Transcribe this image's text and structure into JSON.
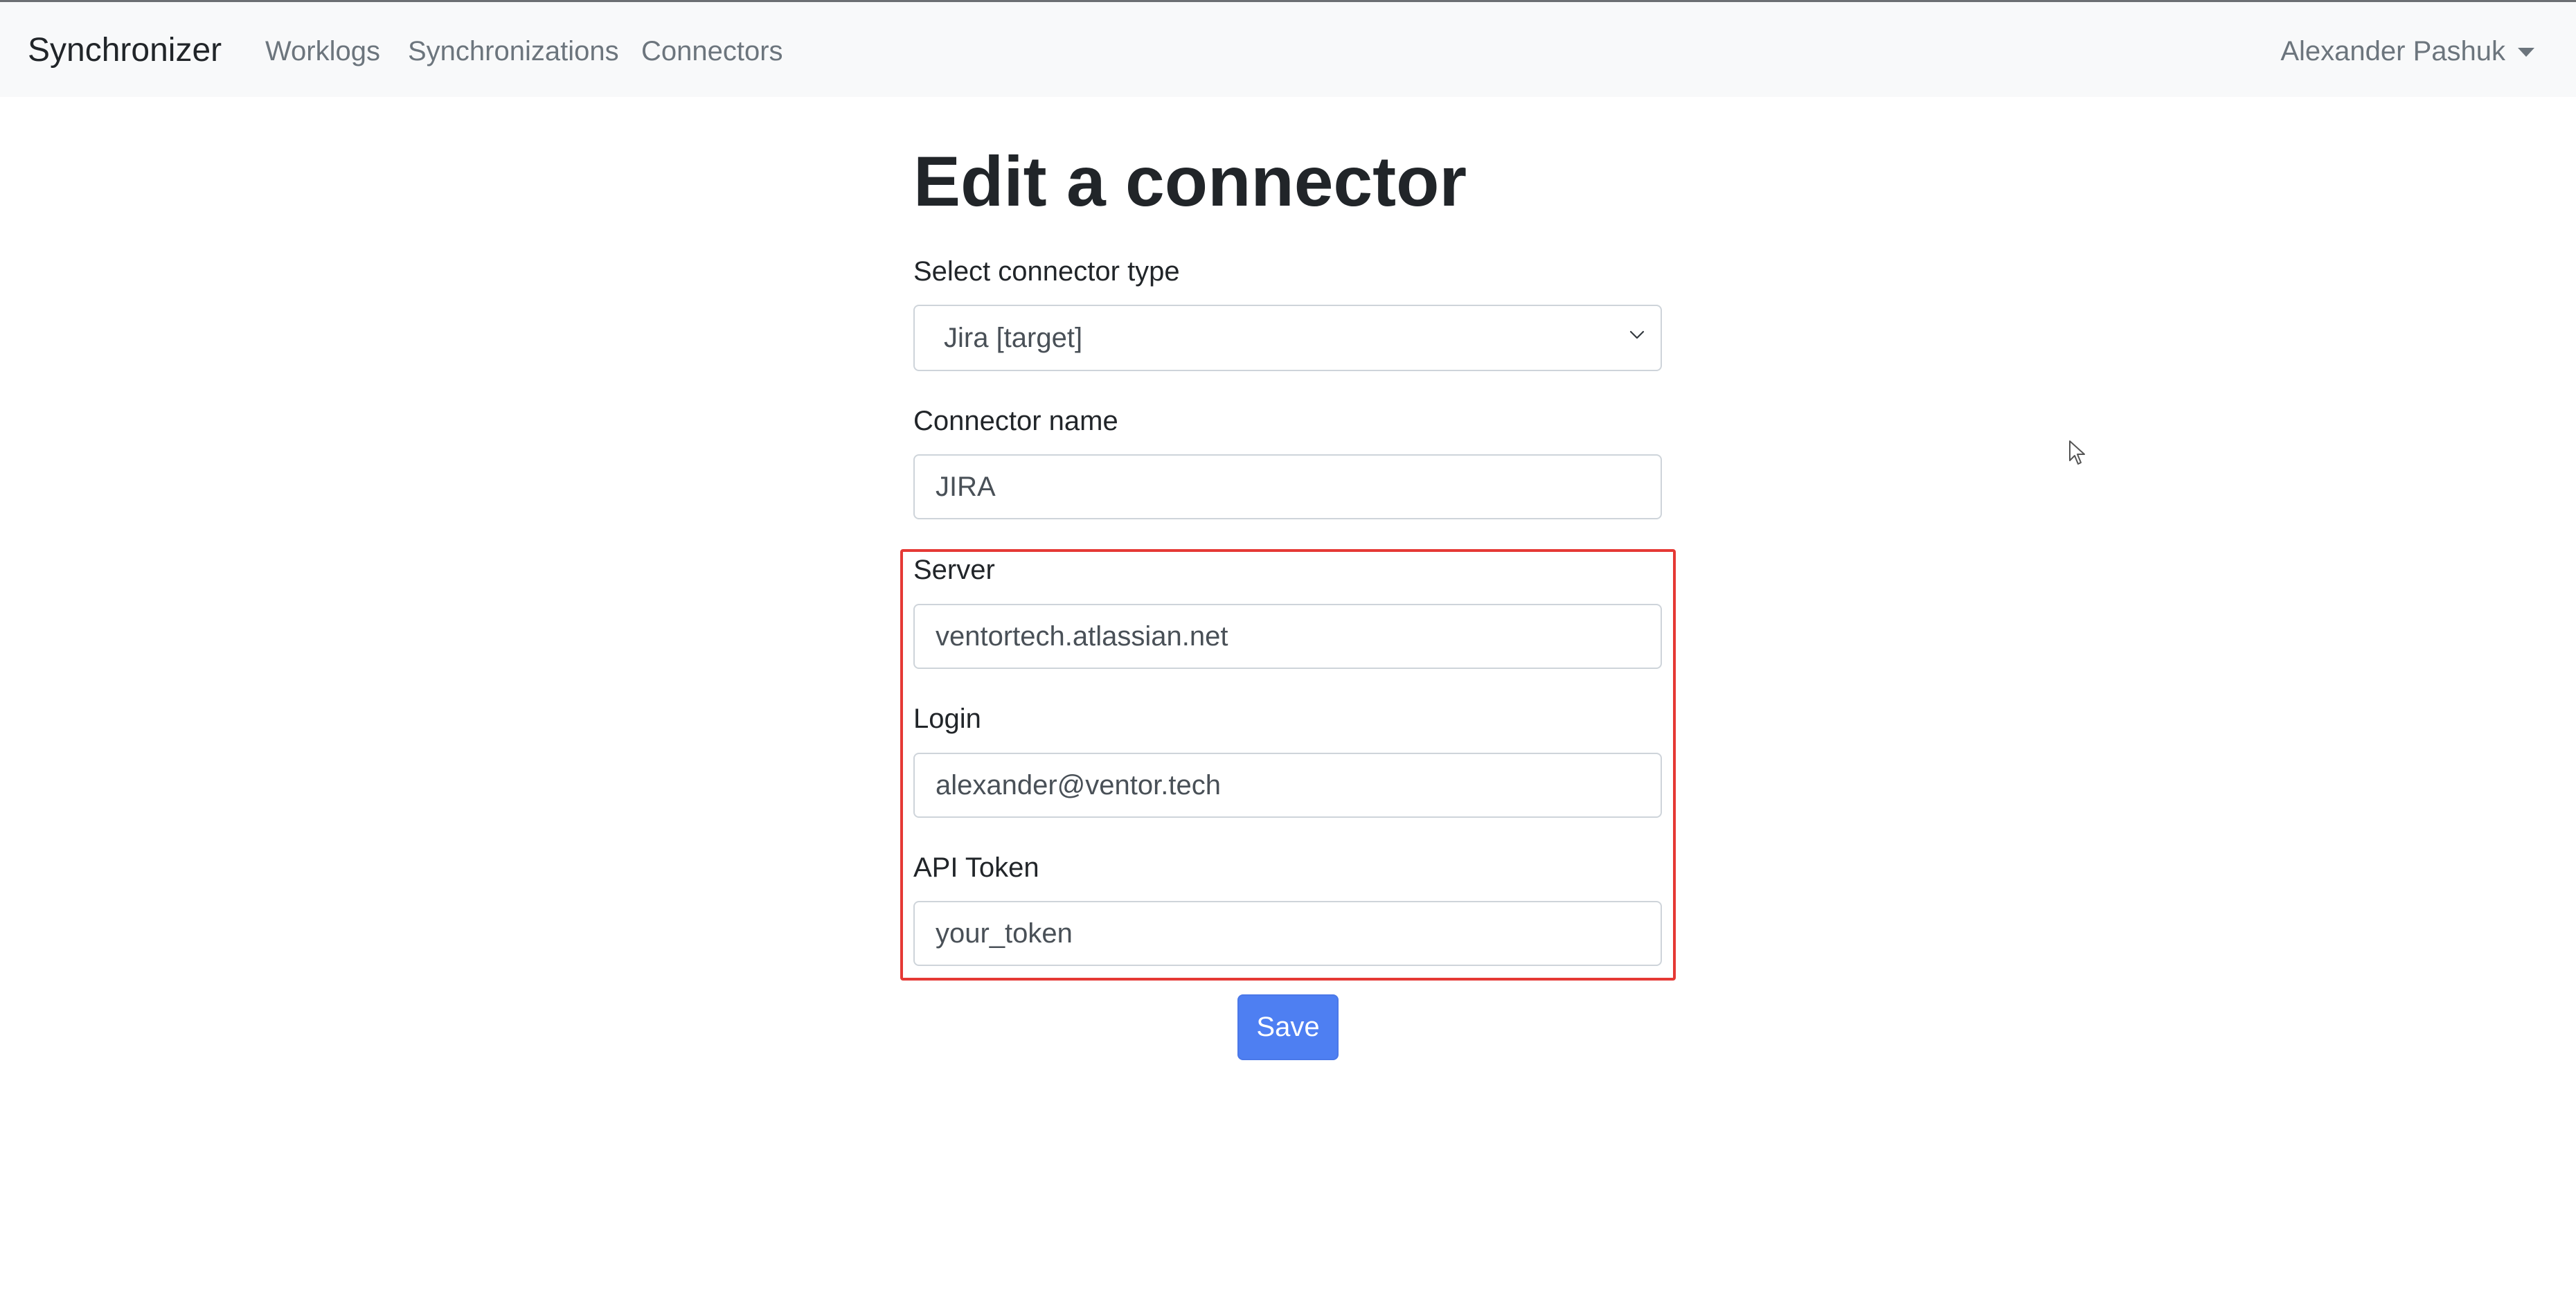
{
  "navbar": {
    "brand": "Synchronizer",
    "links": [
      {
        "label": "Worklogs"
      },
      {
        "label": "Synchronizations"
      },
      {
        "label": "Connectors"
      }
    ],
    "user": {
      "name": "Alexander Pashuk",
      "icon": "caret-down-icon"
    }
  },
  "page": {
    "title": "Edit a connector"
  },
  "form": {
    "connector_type": {
      "label": "Select connector type",
      "value": "Jira [target]",
      "icon": "chevron-down-icon"
    },
    "connector_name": {
      "label": "Connector name",
      "value": "JIRA"
    },
    "server": {
      "label": "Server",
      "value": "ventortech.atlassian.net"
    },
    "login": {
      "label": "Login",
      "value": "alexander@ventor.tech"
    },
    "api_token": {
      "label": "API Token",
      "value": "your_token"
    },
    "save_label": "Save"
  },
  "colors": {
    "navbar_bg": "#f8f9fa",
    "primary_button": "#4e7ff2",
    "highlight_border": "#e53935",
    "nav_link": "#6c757d"
  }
}
